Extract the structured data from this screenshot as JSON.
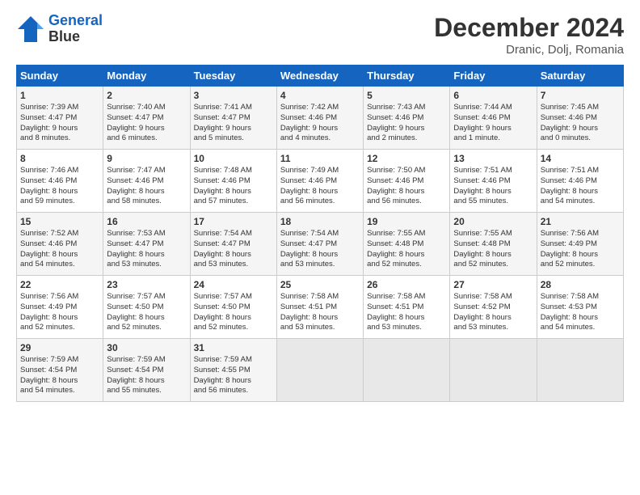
{
  "header": {
    "logo_line1": "General",
    "logo_line2": "Blue",
    "month": "December 2024",
    "location": "Dranic, Dolj, Romania"
  },
  "days_of_week": [
    "Sunday",
    "Monday",
    "Tuesday",
    "Wednesday",
    "Thursday",
    "Friday",
    "Saturday"
  ],
  "weeks": [
    [
      {
        "day": 1,
        "lines": [
          "Sunrise: 7:39 AM",
          "Sunset: 4:47 PM",
          "Daylight: 9 hours",
          "and 8 minutes."
        ]
      },
      {
        "day": 2,
        "lines": [
          "Sunrise: 7:40 AM",
          "Sunset: 4:47 PM",
          "Daylight: 9 hours",
          "and 6 minutes."
        ]
      },
      {
        "day": 3,
        "lines": [
          "Sunrise: 7:41 AM",
          "Sunset: 4:47 PM",
          "Daylight: 9 hours",
          "and 5 minutes."
        ]
      },
      {
        "day": 4,
        "lines": [
          "Sunrise: 7:42 AM",
          "Sunset: 4:46 PM",
          "Daylight: 9 hours",
          "and 4 minutes."
        ]
      },
      {
        "day": 5,
        "lines": [
          "Sunrise: 7:43 AM",
          "Sunset: 4:46 PM",
          "Daylight: 9 hours",
          "and 2 minutes."
        ]
      },
      {
        "day": 6,
        "lines": [
          "Sunrise: 7:44 AM",
          "Sunset: 4:46 PM",
          "Daylight: 9 hours",
          "and 1 minute."
        ]
      },
      {
        "day": 7,
        "lines": [
          "Sunrise: 7:45 AM",
          "Sunset: 4:46 PM",
          "Daylight: 9 hours",
          "and 0 minutes."
        ]
      }
    ],
    [
      {
        "day": 8,
        "lines": [
          "Sunrise: 7:46 AM",
          "Sunset: 4:46 PM",
          "Daylight: 8 hours",
          "and 59 minutes."
        ]
      },
      {
        "day": 9,
        "lines": [
          "Sunrise: 7:47 AM",
          "Sunset: 4:46 PM",
          "Daylight: 8 hours",
          "and 58 minutes."
        ]
      },
      {
        "day": 10,
        "lines": [
          "Sunrise: 7:48 AM",
          "Sunset: 4:46 PM",
          "Daylight: 8 hours",
          "and 57 minutes."
        ]
      },
      {
        "day": 11,
        "lines": [
          "Sunrise: 7:49 AM",
          "Sunset: 4:46 PM",
          "Daylight: 8 hours",
          "and 56 minutes."
        ]
      },
      {
        "day": 12,
        "lines": [
          "Sunrise: 7:50 AM",
          "Sunset: 4:46 PM",
          "Daylight: 8 hours",
          "and 56 minutes."
        ]
      },
      {
        "day": 13,
        "lines": [
          "Sunrise: 7:51 AM",
          "Sunset: 4:46 PM",
          "Daylight: 8 hours",
          "and 55 minutes."
        ]
      },
      {
        "day": 14,
        "lines": [
          "Sunrise: 7:51 AM",
          "Sunset: 4:46 PM",
          "Daylight: 8 hours",
          "and 54 minutes."
        ]
      }
    ],
    [
      {
        "day": 15,
        "lines": [
          "Sunrise: 7:52 AM",
          "Sunset: 4:46 PM",
          "Daylight: 8 hours",
          "and 54 minutes."
        ]
      },
      {
        "day": 16,
        "lines": [
          "Sunrise: 7:53 AM",
          "Sunset: 4:47 PM",
          "Daylight: 8 hours",
          "and 53 minutes."
        ]
      },
      {
        "day": 17,
        "lines": [
          "Sunrise: 7:54 AM",
          "Sunset: 4:47 PM",
          "Daylight: 8 hours",
          "and 53 minutes."
        ]
      },
      {
        "day": 18,
        "lines": [
          "Sunrise: 7:54 AM",
          "Sunset: 4:47 PM",
          "Daylight: 8 hours",
          "and 53 minutes."
        ]
      },
      {
        "day": 19,
        "lines": [
          "Sunrise: 7:55 AM",
          "Sunset: 4:48 PM",
          "Daylight: 8 hours",
          "and 52 minutes."
        ]
      },
      {
        "day": 20,
        "lines": [
          "Sunrise: 7:55 AM",
          "Sunset: 4:48 PM",
          "Daylight: 8 hours",
          "and 52 minutes."
        ]
      },
      {
        "day": 21,
        "lines": [
          "Sunrise: 7:56 AM",
          "Sunset: 4:49 PM",
          "Daylight: 8 hours",
          "and 52 minutes."
        ]
      }
    ],
    [
      {
        "day": 22,
        "lines": [
          "Sunrise: 7:56 AM",
          "Sunset: 4:49 PM",
          "Daylight: 8 hours",
          "and 52 minutes."
        ]
      },
      {
        "day": 23,
        "lines": [
          "Sunrise: 7:57 AM",
          "Sunset: 4:50 PM",
          "Daylight: 8 hours",
          "and 52 minutes."
        ]
      },
      {
        "day": 24,
        "lines": [
          "Sunrise: 7:57 AM",
          "Sunset: 4:50 PM",
          "Daylight: 8 hours",
          "and 52 minutes."
        ]
      },
      {
        "day": 25,
        "lines": [
          "Sunrise: 7:58 AM",
          "Sunset: 4:51 PM",
          "Daylight: 8 hours",
          "and 53 minutes."
        ]
      },
      {
        "day": 26,
        "lines": [
          "Sunrise: 7:58 AM",
          "Sunset: 4:51 PM",
          "Daylight: 8 hours",
          "and 53 minutes."
        ]
      },
      {
        "day": 27,
        "lines": [
          "Sunrise: 7:58 AM",
          "Sunset: 4:52 PM",
          "Daylight: 8 hours",
          "and 53 minutes."
        ]
      },
      {
        "day": 28,
        "lines": [
          "Sunrise: 7:58 AM",
          "Sunset: 4:53 PM",
          "Daylight: 8 hours",
          "and 54 minutes."
        ]
      }
    ],
    [
      {
        "day": 29,
        "lines": [
          "Sunrise: 7:59 AM",
          "Sunset: 4:54 PM",
          "Daylight: 8 hours",
          "and 54 minutes."
        ]
      },
      {
        "day": 30,
        "lines": [
          "Sunrise: 7:59 AM",
          "Sunset: 4:54 PM",
          "Daylight: 8 hours",
          "and 55 minutes."
        ]
      },
      {
        "day": 31,
        "lines": [
          "Sunrise: 7:59 AM",
          "Sunset: 4:55 PM",
          "Daylight: 8 hours",
          "and 56 minutes."
        ]
      },
      null,
      null,
      null,
      null
    ]
  ]
}
